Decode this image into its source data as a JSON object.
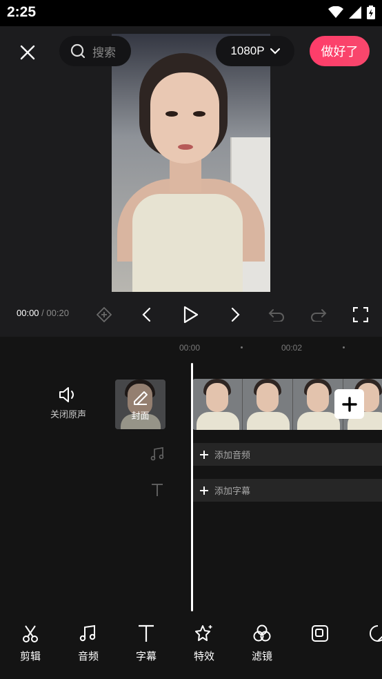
{
  "status_bar": {
    "time": "2:25"
  },
  "header": {
    "search_placeholder": "搜索",
    "resolution": "1080P",
    "done_label": "做好了",
    "done_color": "#ff3d6a"
  },
  "playback": {
    "current_time": "00:00",
    "separator": "/",
    "total_time": "00:20"
  },
  "timeline": {
    "ruler": [
      "00:00",
      "00:02"
    ],
    "mute_label": "关闭原声",
    "cover_label": "封面",
    "add_audio_label": "添加音频",
    "add_subtitle_label": "添加字幕"
  },
  "toolbar": {
    "items": [
      {
        "label": "剪辑",
        "icon": "scissors-icon"
      },
      {
        "label": "音频",
        "icon": "music-note-icon"
      },
      {
        "label": "字幕",
        "icon": "text-icon"
      },
      {
        "label": "特效",
        "icon": "sparkle-star-icon"
      },
      {
        "label": "滤镜",
        "icon": "filter-circles-icon"
      },
      {
        "label": "",
        "icon": "picture-in-picture-icon"
      },
      {
        "label": "",
        "icon": "sticker-icon"
      }
    ]
  }
}
